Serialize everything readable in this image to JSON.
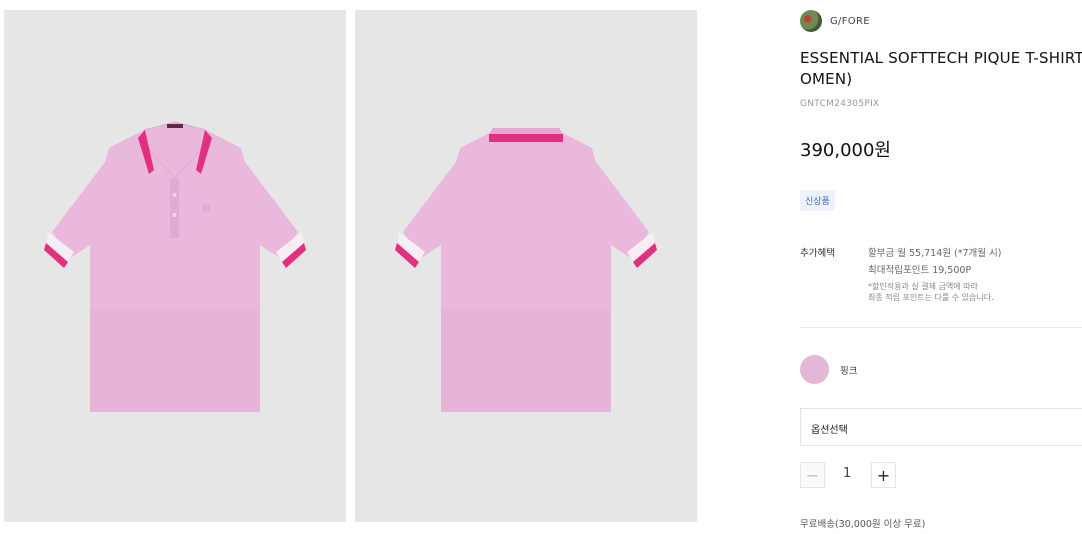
{
  "colors": {
    "shirt_main": "#ebb8dd",
    "shirt_shade": "#e2a9d2",
    "accent_pink": "#e0307f",
    "cuff_white": "#f7eef5",
    "panel_bg": "#e6e6e6"
  },
  "brand": {
    "name": "G/FORE",
    "logo_icon": "brand-logo-icon"
  },
  "product": {
    "title": "ESSENTIAL SOFTTECH PIQUE T-SHIRT (W\nOMEN)",
    "code": "GNTCM24305PIX",
    "price": "390,000원",
    "badge": "신상품"
  },
  "benefits": {
    "label": "추가혜택",
    "line1": "할부금 월 55,714원 (*7개월 시)",
    "line2": "최대적립포인트 19,500P",
    "note": "*할인적용과 실 결제 금액에 따라\n최종 적립 포인트는 다를 수 있습니다."
  },
  "color_option": {
    "name": "핑크",
    "hex": "#e3b8d6"
  },
  "option_select": {
    "placeholder": "옵션선택"
  },
  "quantity": {
    "minus": "−",
    "value": "1",
    "plus": "+"
  },
  "shipping": "무료배송(30,000원 이상 무료)"
}
